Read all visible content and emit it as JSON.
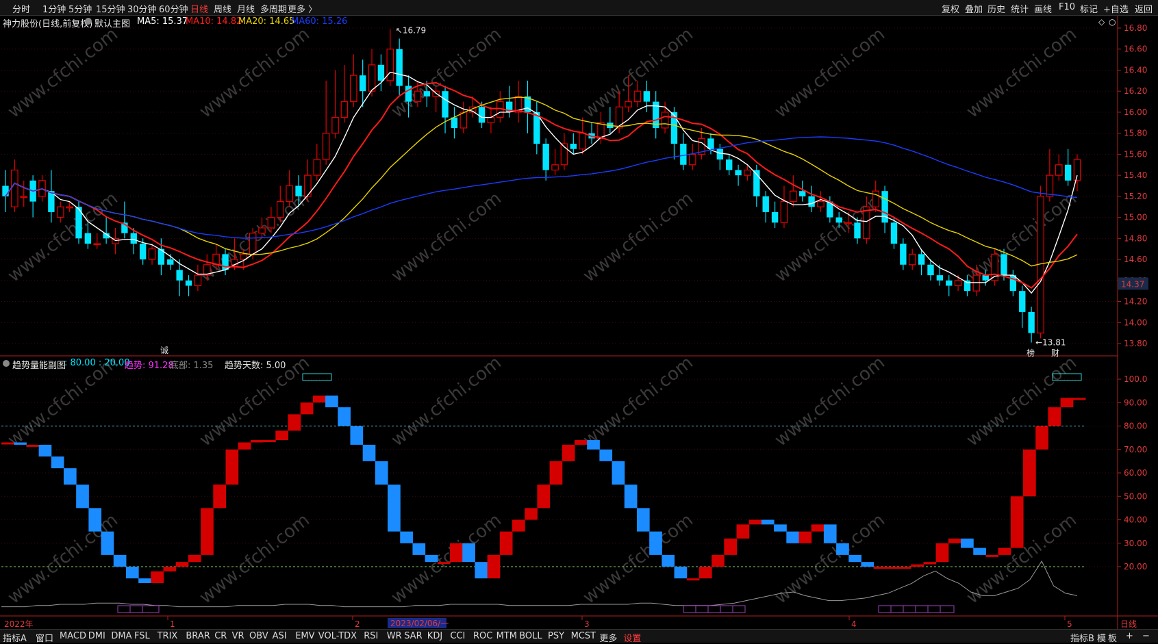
{
  "toolbar": {
    "left": [
      "分时",
      "1分钟",
      "5分钟",
      "15分钟",
      "30分钟",
      "60分钟",
      "日线",
      "周线",
      "月线",
      "多周期",
      "更多 〉"
    ],
    "active": "日线",
    "right": [
      "复权",
      "叠加",
      "历史",
      "统计",
      "画线",
      "F10",
      "标记",
      "+自选",
      "返回"
    ]
  },
  "header": {
    "stock_name": "神力股份",
    "period_label": "(日线,前复权)",
    "main_chart_label": "默认主图",
    "ma5": "MA5: 15.37",
    "ma10": "MA10: 14.82",
    "ma20": "MA20: 14.65",
    "ma60": "MA60: 15.26"
  },
  "colors": {
    "up": "#e60000",
    "down": "#00e5ff",
    "ma5": "#ffffff",
    "ma10": "#ff1a1a",
    "ma20": "#e6d200",
    "ma60": "#1a3cff",
    "axis": "#e23b3b",
    "cyan_label": "#00e5ff",
    "magenta_label": "#ff33ff"
  },
  "price_axis": [
    "16.80",
    "16.60",
    "16.40",
    "16.20",
    "16.00",
    "15.80",
    "15.60",
    "15.40",
    "15.20",
    "15.00",
    "14.80",
    "14.60",
    "14.40",
    "14.20",
    "14.00",
    "13.80"
  ],
  "current_price": "14.37",
  "annotations": {
    "high": "16.79",
    "low": "13.81",
    "tag_cheng": "诚",
    "tag_bang": "榜",
    "tag_cai": "财"
  },
  "indicator": {
    "name": "趋势量能副图",
    "params": ": 80.00 : 20.00",
    "trend_label": "趋势: 91.28",
    "bottom_label": "底部: 1.35",
    "days_label": "趋势天数: 5.00",
    "axis": [
      "100.0",
      "90.00",
      "80.00",
      "70.00",
      "60.00",
      "50.00",
      "40.00",
      "30.00",
      "20.00"
    ]
  },
  "x_axis": {
    "year_label": "2022年",
    "months": [
      "1",
      "2",
      "3",
      "4",
      "5"
    ],
    "date_box": "2023/02/06/一",
    "period_label": "日线"
  },
  "bottom_tabs": {
    "items": [
      "指标A",
      "窗口",
      "MACD",
      "DMI",
      "DMA",
      "FSL",
      "TRIX",
      "BRAR",
      "CR",
      "VR",
      "OBV",
      "ASI",
      "EMV",
      "VOL-TDX",
      "RSI",
      "WR",
      "SAR",
      "KDJ",
      "CCI",
      "ROC",
      "MTM",
      "BOLL",
      "PSY",
      "MCST",
      "更多",
      "设置"
    ],
    "active": "设置",
    "right": [
      "指标B",
      "模",
      "板",
      "+",
      "−"
    ]
  },
  "watermark": "www.cfchi.com",
  "chart_data": {
    "type": "candlestick",
    "note_units": "price in CNY",
    "candles": [
      [
        15.3,
        15.2,
        15.45,
        15.05
      ],
      [
        15.1,
        15.45,
        15.55,
        15.05
      ],
      [
        15.2,
        15.2,
        15.35,
        15.1
      ],
      [
        15.35,
        15.15,
        15.4,
        15.0
      ],
      [
        15.2,
        15.35,
        15.4,
        15.15
      ],
      [
        15.25,
        15.05,
        15.45,
        14.95
      ],
      [
        15.0,
        15.1,
        15.15,
        14.95
      ],
      [
        15.1,
        15.1,
        15.15,
        15.05
      ],
      [
        15.1,
        14.8,
        15.15,
        14.75
      ],
      [
        14.85,
        14.75,
        14.95,
        14.7
      ],
      [
        14.75,
        14.75,
        14.85,
        14.7
      ],
      [
        14.85,
        14.8,
        15.0,
        14.75
      ],
      [
        14.75,
        14.8,
        14.9,
        14.65
      ],
      [
        14.95,
        14.85,
        15.15,
        14.8
      ],
      [
        14.85,
        14.75,
        14.9,
        14.65
      ],
      [
        14.75,
        14.6,
        14.8,
        14.55
      ],
      [
        14.6,
        14.7,
        14.75,
        14.55
      ],
      [
        14.7,
        14.55,
        14.8,
        14.45
      ],
      [
        14.6,
        14.55,
        14.65,
        14.5
      ],
      [
        14.5,
        14.4,
        14.6,
        14.25
      ],
      [
        14.4,
        14.35,
        14.45,
        14.25
      ],
      [
        14.35,
        14.45,
        14.55,
        14.3
      ],
      [
        14.45,
        14.55,
        14.65,
        14.4
      ],
      [
        14.55,
        14.65,
        14.75,
        14.5
      ],
      [
        14.65,
        14.5,
        14.7,
        14.45
      ],
      [
        14.55,
        14.6,
        14.8,
        14.5
      ],
      [
        14.6,
        14.65,
        14.7,
        14.5
      ],
      [
        14.65,
        14.85,
        14.9,
        14.6
      ],
      [
        14.85,
        14.9,
        15.0,
        14.8
      ],
      [
        14.9,
        15.0,
        15.1,
        14.85
      ],
      [
        15.0,
        15.15,
        15.3,
        14.95
      ],
      [
        15.15,
        15.3,
        15.45,
        15.1
      ],
      [
        15.3,
        15.2,
        15.4,
        15.1
      ],
      [
        15.2,
        15.4,
        15.55,
        15.15
      ],
      [
        15.4,
        15.55,
        15.7,
        15.35
      ],
      [
        15.55,
        15.8,
        16.3,
        15.5
      ],
      [
        15.8,
        15.95,
        16.4,
        15.75
      ],
      [
        15.95,
        16.1,
        16.45,
        15.9
      ],
      [
        16.1,
        16.35,
        16.55,
        16.05
      ],
      [
        16.35,
        16.2,
        16.5,
        16.05
      ],
      [
        16.2,
        16.45,
        16.6,
        16.15
      ],
      [
        16.45,
        16.3,
        16.55,
        16.2
      ],
      [
        16.3,
        16.6,
        16.79,
        16.25
      ],
      [
        16.6,
        16.25,
        16.7,
        16.15
      ],
      [
        16.25,
        16.1,
        16.35,
        15.95
      ],
      [
        16.1,
        16.2,
        16.3,
        16.05
      ],
      [
        16.2,
        16.15,
        16.3,
        16.05
      ],
      [
        16.15,
        16.2,
        16.25,
        16.0
      ],
      [
        16.2,
        15.95,
        16.25,
        15.8
      ],
      [
        15.95,
        15.85,
        16.05,
        15.75
      ],
      [
        15.85,
        16.0,
        16.1,
        15.8
      ],
      [
        16.0,
        16.05,
        16.15,
        15.95
      ],
      [
        16.05,
        15.9,
        16.1,
        15.85
      ],
      [
        15.9,
        15.95,
        16.05,
        15.8
      ],
      [
        15.95,
        16.1,
        16.2,
        15.9
      ],
      [
        16.1,
        16.0,
        16.25,
        15.95
      ],
      [
        16.0,
        16.15,
        16.3,
        15.9
      ],
      [
        16.15,
        16.0,
        16.3,
        15.8
      ],
      [
        16.0,
        15.7,
        16.1,
        15.6
      ],
      [
        15.7,
        15.45,
        15.75,
        15.35
      ],
      [
        15.45,
        15.5,
        15.65,
        15.4
      ],
      [
        15.5,
        15.7,
        15.8,
        15.45
      ],
      [
        15.7,
        15.65,
        15.8,
        15.6
      ],
      [
        15.65,
        15.8,
        15.95,
        15.6
      ],
      [
        15.8,
        15.75,
        15.9,
        15.7
      ],
      [
        15.75,
        15.9,
        16.0,
        15.7
      ],
      [
        15.9,
        15.85,
        16.05,
        15.8
      ],
      [
        15.85,
        16.05,
        16.2,
        15.8
      ],
      [
        16.05,
        16.1,
        16.35,
        16.0
      ],
      [
        16.1,
        16.2,
        16.3,
        16.05
      ],
      [
        16.2,
        16.1,
        16.3,
        16.0
      ],
      [
        16.1,
        15.85,
        16.2,
        15.75
      ],
      [
        15.85,
        16.0,
        16.1,
        15.8
      ],
      [
        16.0,
        15.7,
        16.05,
        15.55
      ],
      [
        15.7,
        15.5,
        15.8,
        15.45
      ],
      [
        15.5,
        15.6,
        15.7,
        15.45
      ],
      [
        15.6,
        15.75,
        15.85,
        15.55
      ],
      [
        15.75,
        15.65,
        15.8,
        15.6
      ],
      [
        15.65,
        15.55,
        15.7,
        15.45
      ],
      [
        15.55,
        15.45,
        15.6,
        15.4
      ],
      [
        15.45,
        15.4,
        15.5,
        15.3
      ],
      [
        15.4,
        15.45,
        15.5,
        15.35
      ],
      [
        15.45,
        15.2,
        15.5,
        15.1
      ],
      [
        15.2,
        15.05,
        15.25,
        14.95
      ],
      [
        15.05,
        14.95,
        15.15,
        14.9
      ],
      [
        14.95,
        15.15,
        15.3,
        14.9
      ],
      [
        15.15,
        15.25,
        15.4,
        15.1
      ],
      [
        15.25,
        15.2,
        15.35,
        15.15
      ],
      [
        15.2,
        15.1,
        15.3,
        15.05
      ],
      [
        15.1,
        15.15,
        15.25,
        15.05
      ],
      [
        15.15,
        15.0,
        15.2,
        14.95
      ],
      [
        15.0,
        14.95,
        15.05,
        14.9
      ],
      [
        14.95,
        14.95,
        15.05,
        14.85
      ],
      [
        14.95,
        14.8,
        15.0,
        14.75
      ],
      [
        14.8,
        15.1,
        15.2,
        14.75
      ],
      [
        15.1,
        15.25,
        15.35,
        15.05
      ],
      [
        15.25,
        14.95,
        15.3,
        14.85
      ],
      [
        14.95,
        14.75,
        15.0,
        14.7
      ],
      [
        14.75,
        14.55,
        14.8,
        14.5
      ],
      [
        14.55,
        14.65,
        14.7,
        14.5
      ],
      [
        14.65,
        14.55,
        14.7,
        14.45
      ],
      [
        14.55,
        14.45,
        14.6,
        14.4
      ],
      [
        14.45,
        14.4,
        14.55,
        14.35
      ],
      [
        14.4,
        14.35,
        14.45,
        14.25
      ],
      [
        14.35,
        14.4,
        14.45,
        14.3
      ],
      [
        14.4,
        14.3,
        14.45,
        14.25
      ],
      [
        14.3,
        14.45,
        14.55,
        14.25
      ],
      [
        14.45,
        14.4,
        14.5,
        14.35
      ],
      [
        14.4,
        14.65,
        14.7,
        14.35
      ],
      [
        14.65,
        14.45,
        14.7,
        14.4
      ],
      [
        14.45,
        14.3,
        14.5,
        14.25
      ],
      [
        14.3,
        14.1,
        14.35,
        13.95
      ],
      [
        14.1,
        13.9,
        14.15,
        13.81
      ],
      [
        13.9,
        15.2,
        15.3,
        13.85
      ],
      [
        15.2,
        15.4,
        15.65,
        15.15
      ],
      [
        15.4,
        15.5,
        15.6,
        15.35
      ],
      [
        15.5,
        15.35,
        15.65,
        15.3
      ],
      [
        15.35,
        15.55,
        15.6,
        15.25
      ]
    ],
    "indicator_steps": [
      73,
      72,
      72,
      67,
      62,
      55,
      45,
      35,
      25,
      20,
      15,
      13,
      18,
      20,
      22,
      25,
      45,
      55,
      70,
      73,
      74,
      74,
      78,
      85,
      90,
      93,
      88,
      80,
      72,
      65,
      55,
      35,
      30,
      25,
      22,
      22,
      30,
      22,
      15,
      25,
      35,
      40,
      45,
      55,
      65,
      72,
      74,
      70,
      65,
      55,
      45,
      35,
      25,
      20,
      15,
      15,
      20,
      25,
      32,
      38,
      40,
      38,
      35,
      30,
      35,
      38,
      30,
      25,
      22,
      20,
      20,
      20,
      20,
      21,
      22,
      30,
      32,
      28,
      25,
      25,
      28,
      50,
      70,
      80,
      88,
      92,
      92
    ],
    "indicator_ref_lines": [
      80,
      20
    ]
  }
}
